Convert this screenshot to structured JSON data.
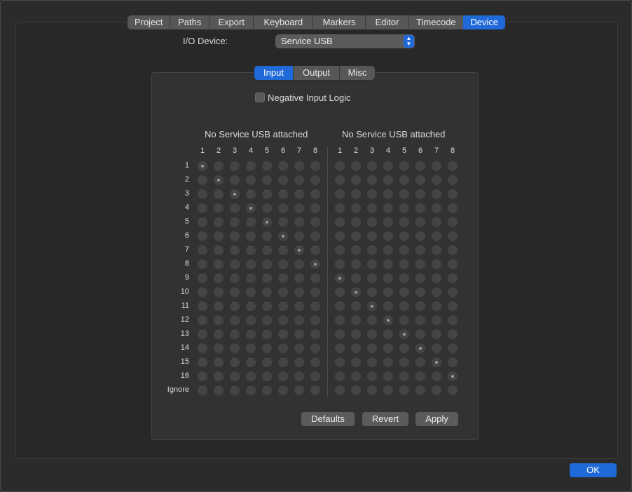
{
  "tabs": [
    "Project",
    "Paths",
    "Export",
    "Keyboard",
    "Markers",
    "Editor",
    "Timecode",
    "Device"
  ],
  "active_tab": "Device",
  "io_device": {
    "label": "I/O Device:",
    "value": "Service USB"
  },
  "subtabs": [
    "Input",
    "Output",
    "Misc"
  ],
  "active_subtab": "Input",
  "negative_logic": {
    "label": "Negative Input Logic",
    "checked": false
  },
  "matrix": {
    "left_title": "No Service USB attached",
    "right_title": "No Service USB attached",
    "columns": [
      "1",
      "2",
      "3",
      "4",
      "5",
      "6",
      "7",
      "8"
    ],
    "rows": [
      "1",
      "2",
      "3",
      "4",
      "5",
      "6",
      "7",
      "8",
      "9",
      "10",
      "11",
      "12",
      "13",
      "14",
      "15",
      "16",
      "Ignore"
    ]
  },
  "buttons": {
    "defaults": "Defaults",
    "revert": "Revert",
    "apply": "Apply",
    "ok": "OK"
  }
}
